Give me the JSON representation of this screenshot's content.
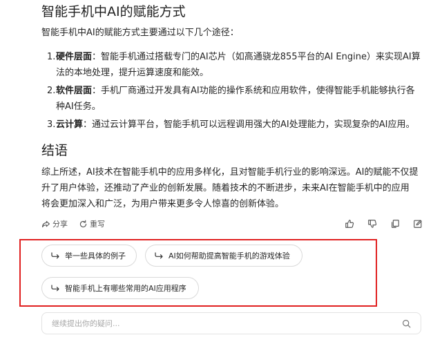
{
  "section1": {
    "heading": "智能手机中AI的赋能方式",
    "intro": "智能手机中AI的赋能方式主要通过以下几个途径：",
    "items": [
      {
        "num": "1.",
        "term": "硬件层面",
        "sep": "：",
        "line1": "智能手机通过搭载专门的AI芯片（如高通骁龙855平台的AI Engine）来实现AI算",
        "line2": "法的本地处理，提升运算速度和能效。"
      },
      {
        "num": "2.",
        "term": "软件层面",
        "sep": "：",
        "line1": "手机厂商通过开发具有AI功能的操作系统和应用软件，使得智能手机能够执行各",
        "line2": "种AI任务。"
      },
      {
        "num": "3.",
        "term": "云计算",
        "sep": "：",
        "line1": "通过云计算平台，智能手机可以远程调用强大的AI处理能力，实现复杂的AI应用。",
        "line2": ""
      }
    ]
  },
  "section2": {
    "heading": "结语",
    "lines": [
      "综上所述，AI技术在智能手机中的应用多样化，且对智能手机行业的影响深远。AI的赋能不仅提",
      "升了用户体验，还推动了产业的创新发展。随着技术的不断进步，未来AI在智能手机中的应用",
      "将会更加深入和广泛，为用户带来更多令人惊喜的创新体验。"
    ]
  },
  "actions": {
    "share_label": "分享",
    "rewrite_label": "重写",
    "icons": [
      "share-icon",
      "refresh-icon",
      "thumbs-up-icon",
      "thumbs-down-icon",
      "copy-icon",
      "edit-icon"
    ]
  },
  "suggestions": [
    "举一些具体的例子",
    "AI如何帮助提高智能手机的游戏体验",
    "智能手机上有哪些常用的AI应用程序"
  ],
  "input": {
    "placeholder": "继续提出你的疑问..."
  },
  "colors": {
    "highlight": "#e01f1f",
    "border": "#d9d9d9",
    "text": "#262626"
  }
}
